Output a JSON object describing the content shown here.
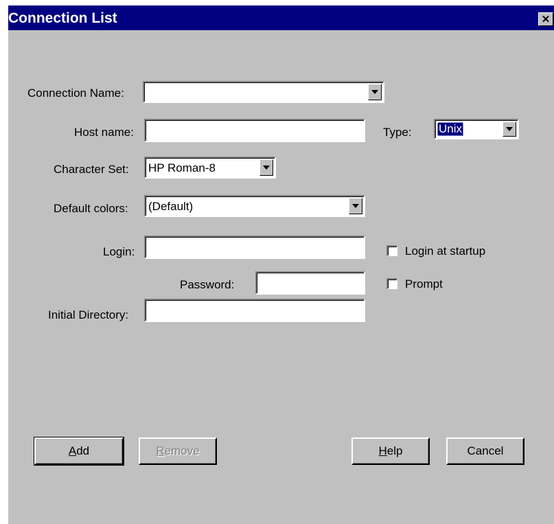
{
  "window": {
    "title": "Connection List",
    "close_symbol": "✕",
    "close_icon": "close-icon"
  },
  "form": {
    "connection_name": {
      "label": "Connection Name:",
      "value": ""
    },
    "host_name": {
      "label": "Host name:",
      "value": ""
    },
    "type": {
      "label": "Type:",
      "value": "Unix"
    },
    "character_set": {
      "label": "Character Set:",
      "value": "HP Roman-8"
    },
    "default_colors": {
      "label": "Default colors:",
      "value": "(Default)"
    },
    "login": {
      "label": "Login:",
      "value": ""
    },
    "login_at_startup": {
      "label": "Login at startup",
      "checked": false
    },
    "password": {
      "label": "Password:",
      "value": ""
    },
    "prompt": {
      "label": "Prompt",
      "checked": false
    },
    "initial_directory": {
      "label": "Initial Directory:",
      "value": ""
    }
  },
  "buttons": {
    "add": {
      "mnemonic": "A",
      "rest": "dd"
    },
    "remove": {
      "mnemonic": "R",
      "rest": "emove",
      "enabled": false
    },
    "help": {
      "mnemonic": "H",
      "rest": "elp"
    },
    "cancel": {
      "label": "Cancel"
    }
  },
  "colors": {
    "titlebar": "#000080",
    "dialog_bg": "#c0c0c0",
    "selection": "#000080"
  }
}
